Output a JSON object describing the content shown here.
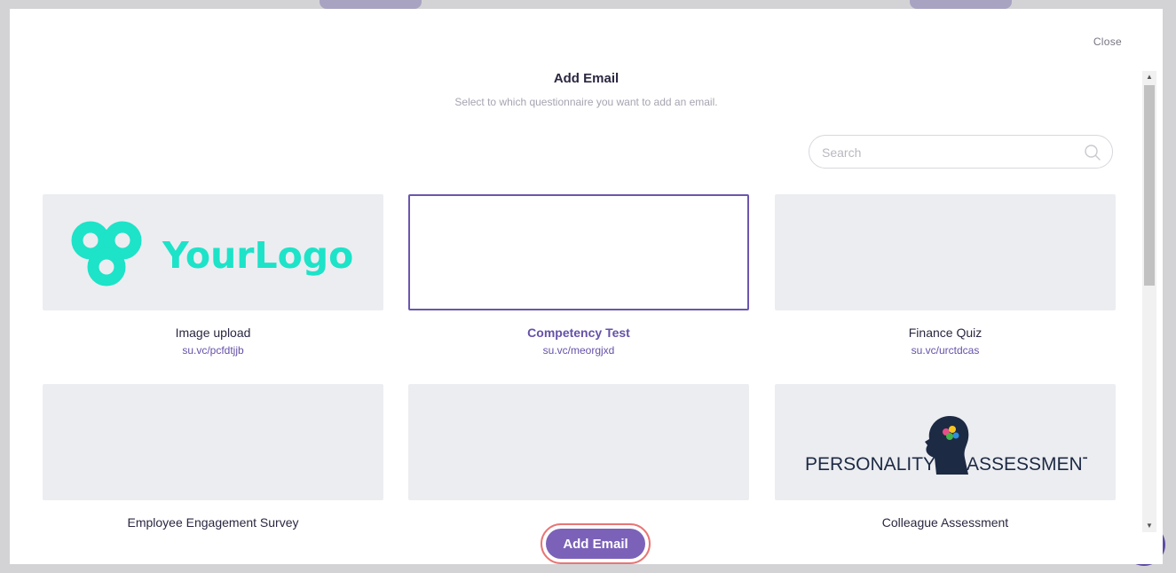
{
  "modal": {
    "close_label": "Close",
    "title": "Add Email",
    "subtitle": "Select to which questionnaire you want to add an email."
  },
  "search": {
    "placeholder": "Search",
    "value": ""
  },
  "questionnaires": [
    {
      "name": "Image upload",
      "link": "su.vc/pcfdtjjb",
      "logo_text": "YourLogo"
    },
    {
      "name": "Competency Test",
      "link": "su.vc/meorgjxd",
      "selected": true
    },
    {
      "name": "Finance Quiz",
      "link": "su.vc/urctdcas"
    },
    {
      "name": "Employee Engagement Survey"
    },
    {
      "name": ""
    },
    {
      "name": "Colleague Assessment",
      "logo_text_left": "PERSONALITY",
      "logo_text_right": "ASSESSMENT"
    }
  ],
  "actions": {
    "add_email_label": "Add Email"
  },
  "colors": {
    "accent": "#6651a8",
    "button": "#7b62b8",
    "highlight_ring": "#e87575",
    "logo_teal": "#1de3c8",
    "card_bg": "#ecedf1"
  }
}
